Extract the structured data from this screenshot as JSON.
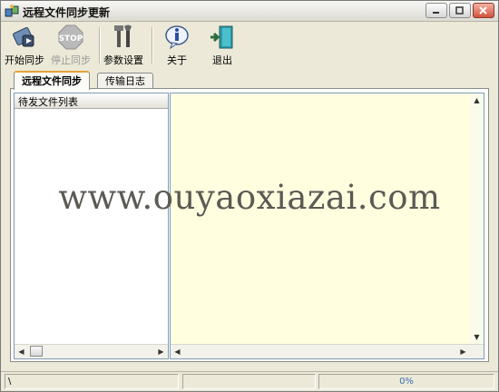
{
  "window": {
    "title": "远程文件同步更新"
  },
  "toolbar": {
    "start": "开始同步",
    "stop": "停止同步",
    "settings": "参数设置",
    "about": "关于",
    "exit": "退出"
  },
  "tabs": [
    {
      "label": "远程文件同步",
      "active": true
    },
    {
      "label": "传输日志",
      "active": false
    }
  ],
  "left_list": {
    "header": "待发文件列表"
  },
  "statusbar": {
    "left": "\\",
    "progress": "0%"
  },
  "watermark": "www.ouyaoxiazai.com",
  "colors": {
    "log_background": "#ffffe0",
    "active_tab_accent": "#e6a23a"
  }
}
